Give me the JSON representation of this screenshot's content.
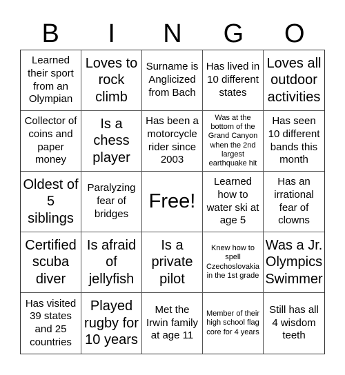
{
  "header": {
    "letters": [
      "B",
      "I",
      "N",
      "G",
      "O"
    ]
  },
  "board": {
    "cells": [
      {
        "text": "Learned their sport from an Olympian",
        "size": "md"
      },
      {
        "text": "Loves to rock climb",
        "size": "lg"
      },
      {
        "text": "Surname is Anglicized from Bach",
        "size": "md"
      },
      {
        "text": "Has lived in 10 different states",
        "size": "md"
      },
      {
        "text": "Loves all outdoor activities",
        "size": "lg"
      },
      {
        "text": "Collector of coins and paper money",
        "size": "md"
      },
      {
        "text": "Is a chess player",
        "size": "lg"
      },
      {
        "text": "Has been a motorcycle rider since 2003",
        "size": "md"
      },
      {
        "text": "Was at the bottom of the Grand Canyon when the 2nd largest earthquake hit",
        "size": "sm"
      },
      {
        "text": "Has seen 10 different bands this month",
        "size": "md"
      },
      {
        "text": "Oldest of 5 siblings",
        "size": "lg"
      },
      {
        "text": "Paralyzing fear of bridges",
        "size": "md"
      },
      {
        "text": "Free!",
        "size": "xl"
      },
      {
        "text": "Learned how to water ski at age 5",
        "size": "md"
      },
      {
        "text": "Has an irrational fear of clowns",
        "size": "md"
      },
      {
        "text": "Certified scuba diver",
        "size": "lg"
      },
      {
        "text": "Is afraid of jellyfish",
        "size": "lg"
      },
      {
        "text": "Is a private pilot",
        "size": "lg"
      },
      {
        "text": "Knew how to spell Czechoslovakia in the 1st grade",
        "size": "sm"
      },
      {
        "text": "Was a Jr. Olympics Swimmer",
        "size": "lg"
      },
      {
        "text": "Has visited 39 states and 25 countries",
        "size": "md"
      },
      {
        "text": "Played rugby for 10 years",
        "size": "lg"
      },
      {
        "text": "Met the Irwin family at age 11",
        "size": "md"
      },
      {
        "text": "Member of their high school flag core for 4 years",
        "size": "sm"
      },
      {
        "text": "Still has all 4 wisdom teeth",
        "size": "md"
      }
    ]
  }
}
